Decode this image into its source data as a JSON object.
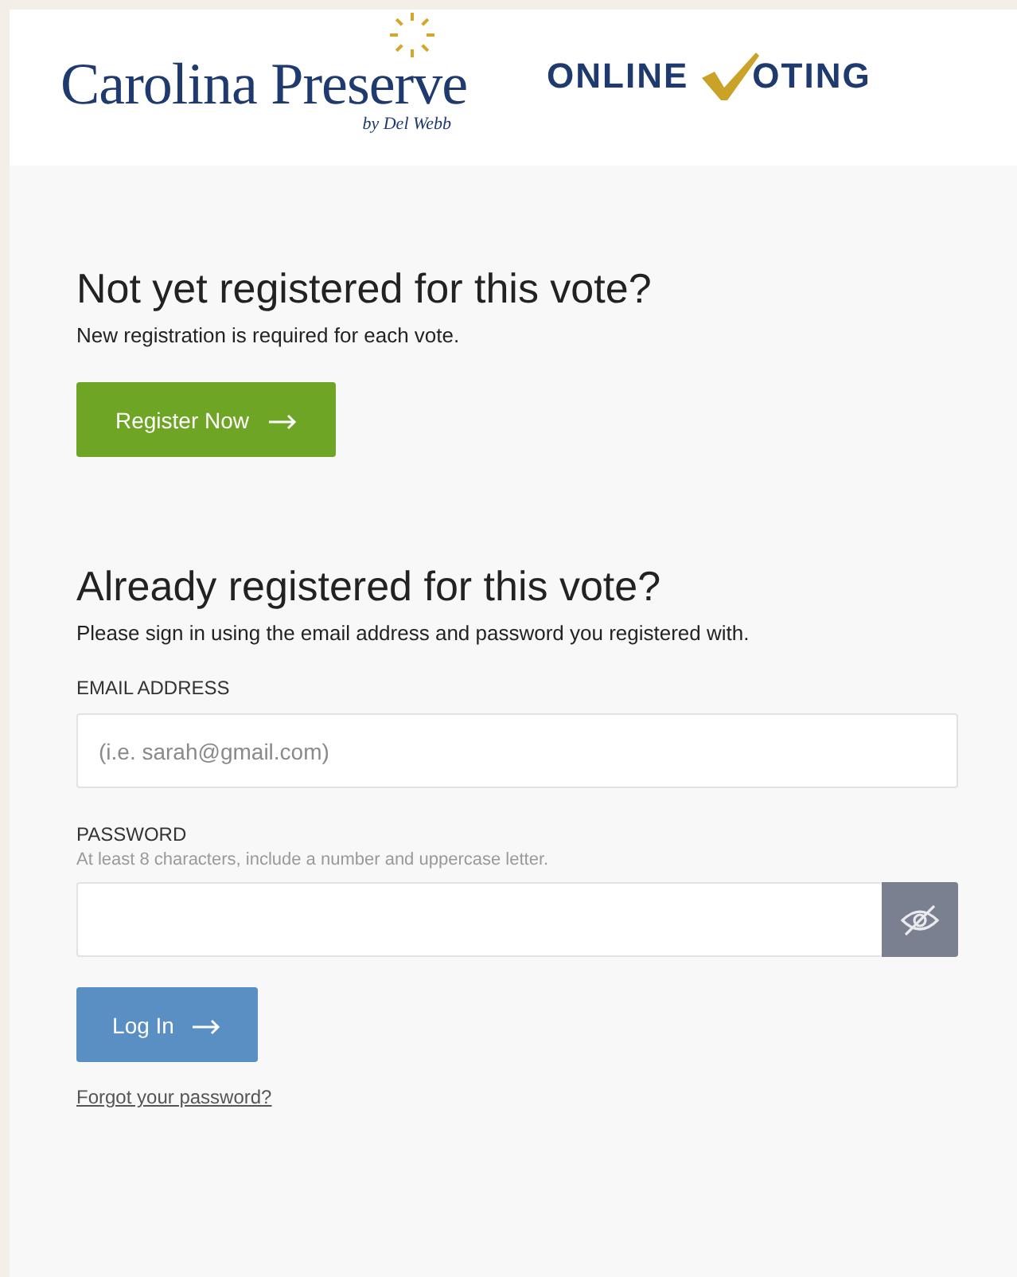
{
  "header": {
    "brand": "Carolina Preserve",
    "byline": "by Del Webb",
    "product_first": "ONLINE",
    "product_rest": "OTING"
  },
  "register": {
    "heading": "Not yet registered for this vote?",
    "text": "New registration is required for each vote.",
    "button": "Register Now"
  },
  "login": {
    "heading": "Already registered for this vote?",
    "text": "Please sign in using the email address and password you registered with.",
    "email": {
      "label": "EMAIL ADDRESS",
      "placeholder": "(i.e. sarah@gmail.com)"
    },
    "password": {
      "label": "PASSWORD",
      "hint": "At least 8 characters, include a number and uppercase letter."
    },
    "button": "Log In",
    "forgot": "Forgot your password?"
  }
}
